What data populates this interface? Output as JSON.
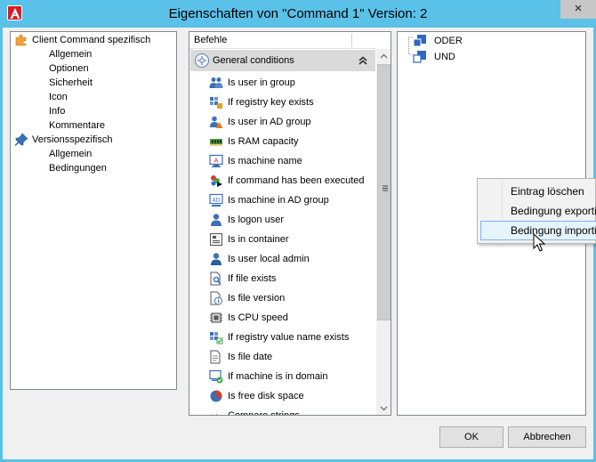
{
  "window": {
    "title": "Eigenschaften von \"Command 1\" Version: 2",
    "close_symbol": "×"
  },
  "left_tree": {
    "group1": {
      "label": "Client Command spezifisch",
      "icon": "puzzle-icon",
      "items": [
        "Allgemein",
        "Optionen",
        "Sicherheit",
        "Icon",
        "Info",
        "Kommentare"
      ]
    },
    "group2": {
      "label": "Versionsspezifisch",
      "icon": "pin-icon",
      "items": [
        "Allgemein",
        "Bedingungen"
      ]
    }
  },
  "commands": {
    "column_header": "Befehle",
    "group_label": "General conditions",
    "items": [
      {
        "label": "Is user in group",
        "icon": "users-icon"
      },
      {
        "label": "If registry key exists",
        "icon": "registry-icon"
      },
      {
        "label": "Is user in AD group",
        "icon": "ad-user-icon"
      },
      {
        "label": "Is RAM capacity",
        "icon": "ram-icon"
      },
      {
        "label": "Is machine name",
        "icon": "monitor-icon"
      },
      {
        "label": "If command has been executed",
        "icon": "command-icon"
      },
      {
        "label": "Is machine in AD group",
        "icon": "ad-machine-icon"
      },
      {
        "label": "Is logon user",
        "icon": "user-icon"
      },
      {
        "label": "Is in container",
        "icon": "container-icon"
      },
      {
        "label": "Is user local admin",
        "icon": "admin-user-icon"
      },
      {
        "label": "If file exists",
        "icon": "file-search-icon"
      },
      {
        "label": "Is file version",
        "icon": "file-info-icon"
      },
      {
        "label": "Is CPU speed",
        "icon": "cpu-icon"
      },
      {
        "label": "If registry value name exists",
        "icon": "registry-value-icon"
      },
      {
        "label": "Is file date",
        "icon": "file-date-icon"
      },
      {
        "label": "If machine is in domain",
        "icon": "domain-machine-icon"
      },
      {
        "label": "Is free disk space",
        "icon": "disk-pie-icon"
      },
      {
        "label": "Compare strings",
        "icon": "strings-icon"
      }
    ]
  },
  "conditions_tree": {
    "items": [
      {
        "label": "ODER"
      },
      {
        "label": "UND"
      }
    ]
  },
  "context_menu": {
    "items": [
      {
        "label": "Eintrag löschen"
      },
      {
        "label": "Bedingung exportieren"
      },
      {
        "label": "Bedingung importieren"
      }
    ]
  },
  "buttons": {
    "ok": "OK",
    "cancel": "Abbrechen"
  },
  "colors": {
    "titlebar": "#5ac1e8",
    "app_icon": "#d41f26",
    "selection": "#e5f3fb",
    "selection_border": "#7eb4ea"
  }
}
